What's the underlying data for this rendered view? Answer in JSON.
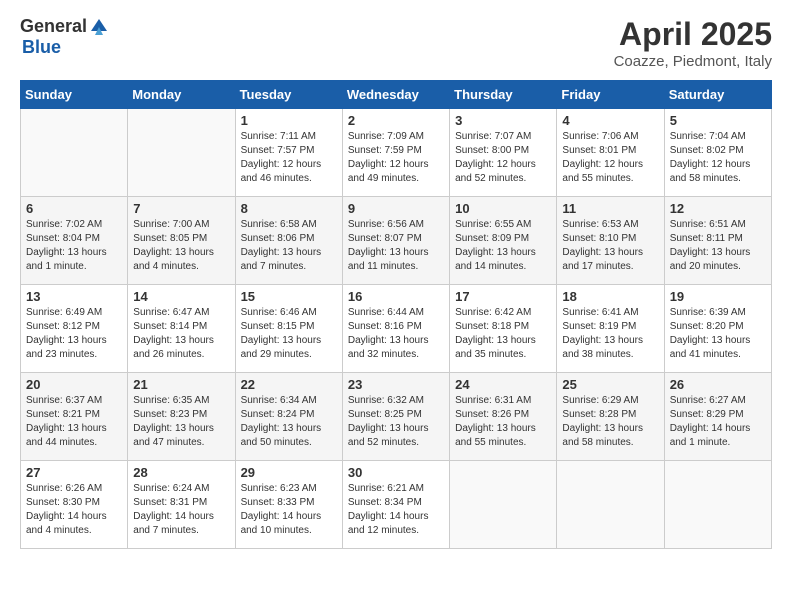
{
  "header": {
    "logo_general": "General",
    "logo_blue": "Blue",
    "title": "April 2025",
    "subtitle": "Coazze, Piedmont, Italy"
  },
  "weekdays": [
    "Sunday",
    "Monday",
    "Tuesday",
    "Wednesday",
    "Thursday",
    "Friday",
    "Saturday"
  ],
  "weeks": [
    [
      {
        "num": "",
        "info": ""
      },
      {
        "num": "",
        "info": ""
      },
      {
        "num": "1",
        "info": "Sunrise: 7:11 AM\nSunset: 7:57 PM\nDaylight: 12 hours and 46 minutes."
      },
      {
        "num": "2",
        "info": "Sunrise: 7:09 AM\nSunset: 7:59 PM\nDaylight: 12 hours and 49 minutes."
      },
      {
        "num": "3",
        "info": "Sunrise: 7:07 AM\nSunset: 8:00 PM\nDaylight: 12 hours and 52 minutes."
      },
      {
        "num": "4",
        "info": "Sunrise: 7:06 AM\nSunset: 8:01 PM\nDaylight: 12 hours and 55 minutes."
      },
      {
        "num": "5",
        "info": "Sunrise: 7:04 AM\nSunset: 8:02 PM\nDaylight: 12 hours and 58 minutes."
      }
    ],
    [
      {
        "num": "6",
        "info": "Sunrise: 7:02 AM\nSunset: 8:04 PM\nDaylight: 13 hours and 1 minute."
      },
      {
        "num": "7",
        "info": "Sunrise: 7:00 AM\nSunset: 8:05 PM\nDaylight: 13 hours and 4 minutes."
      },
      {
        "num": "8",
        "info": "Sunrise: 6:58 AM\nSunset: 8:06 PM\nDaylight: 13 hours and 7 minutes."
      },
      {
        "num": "9",
        "info": "Sunrise: 6:56 AM\nSunset: 8:07 PM\nDaylight: 13 hours and 11 minutes."
      },
      {
        "num": "10",
        "info": "Sunrise: 6:55 AM\nSunset: 8:09 PM\nDaylight: 13 hours and 14 minutes."
      },
      {
        "num": "11",
        "info": "Sunrise: 6:53 AM\nSunset: 8:10 PM\nDaylight: 13 hours and 17 minutes."
      },
      {
        "num": "12",
        "info": "Sunrise: 6:51 AM\nSunset: 8:11 PM\nDaylight: 13 hours and 20 minutes."
      }
    ],
    [
      {
        "num": "13",
        "info": "Sunrise: 6:49 AM\nSunset: 8:12 PM\nDaylight: 13 hours and 23 minutes."
      },
      {
        "num": "14",
        "info": "Sunrise: 6:47 AM\nSunset: 8:14 PM\nDaylight: 13 hours and 26 minutes."
      },
      {
        "num": "15",
        "info": "Sunrise: 6:46 AM\nSunset: 8:15 PM\nDaylight: 13 hours and 29 minutes."
      },
      {
        "num": "16",
        "info": "Sunrise: 6:44 AM\nSunset: 8:16 PM\nDaylight: 13 hours and 32 minutes."
      },
      {
        "num": "17",
        "info": "Sunrise: 6:42 AM\nSunset: 8:18 PM\nDaylight: 13 hours and 35 minutes."
      },
      {
        "num": "18",
        "info": "Sunrise: 6:41 AM\nSunset: 8:19 PM\nDaylight: 13 hours and 38 minutes."
      },
      {
        "num": "19",
        "info": "Sunrise: 6:39 AM\nSunset: 8:20 PM\nDaylight: 13 hours and 41 minutes."
      }
    ],
    [
      {
        "num": "20",
        "info": "Sunrise: 6:37 AM\nSunset: 8:21 PM\nDaylight: 13 hours and 44 minutes."
      },
      {
        "num": "21",
        "info": "Sunrise: 6:35 AM\nSunset: 8:23 PM\nDaylight: 13 hours and 47 minutes."
      },
      {
        "num": "22",
        "info": "Sunrise: 6:34 AM\nSunset: 8:24 PM\nDaylight: 13 hours and 50 minutes."
      },
      {
        "num": "23",
        "info": "Sunrise: 6:32 AM\nSunset: 8:25 PM\nDaylight: 13 hours and 52 minutes."
      },
      {
        "num": "24",
        "info": "Sunrise: 6:31 AM\nSunset: 8:26 PM\nDaylight: 13 hours and 55 minutes."
      },
      {
        "num": "25",
        "info": "Sunrise: 6:29 AM\nSunset: 8:28 PM\nDaylight: 13 hours and 58 minutes."
      },
      {
        "num": "26",
        "info": "Sunrise: 6:27 AM\nSunset: 8:29 PM\nDaylight: 14 hours and 1 minute."
      }
    ],
    [
      {
        "num": "27",
        "info": "Sunrise: 6:26 AM\nSunset: 8:30 PM\nDaylight: 14 hours and 4 minutes."
      },
      {
        "num": "28",
        "info": "Sunrise: 6:24 AM\nSunset: 8:31 PM\nDaylight: 14 hours and 7 minutes."
      },
      {
        "num": "29",
        "info": "Sunrise: 6:23 AM\nSunset: 8:33 PM\nDaylight: 14 hours and 10 minutes."
      },
      {
        "num": "30",
        "info": "Sunrise: 6:21 AM\nSunset: 8:34 PM\nDaylight: 14 hours and 12 minutes."
      },
      {
        "num": "",
        "info": ""
      },
      {
        "num": "",
        "info": ""
      },
      {
        "num": "",
        "info": ""
      }
    ]
  ]
}
